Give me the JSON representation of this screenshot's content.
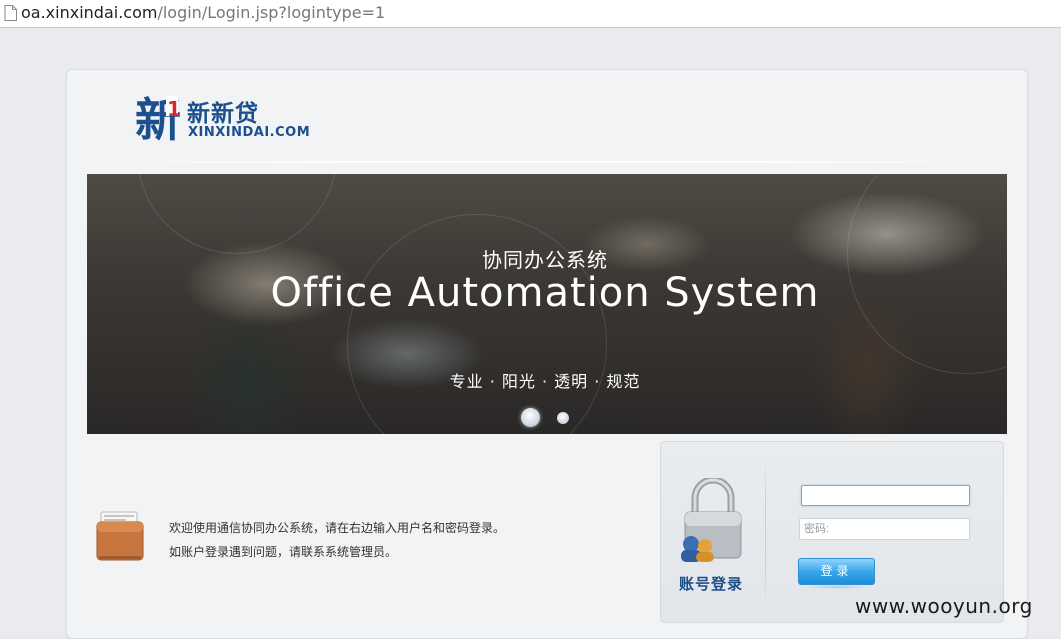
{
  "browser": {
    "url_host": "oa.xinxindai.com",
    "url_path": "/login/Login.jsp?logintype=1",
    "page_icon": "page-icon"
  },
  "logo": {
    "mark_char": "新",
    "mark_digit": "1",
    "cn_name": "新新贷",
    "en_name": "XINXINDAI.COM",
    "brand_color": "#1b4f8e",
    "accent_color": "#d42a2a"
  },
  "banner": {
    "title_cn": "协同办公系统",
    "title_en": "Office Automation System",
    "slogan": "专业 · 阳光 · 透明 · 规范",
    "active_slide": 1,
    "slide_count": 2
  },
  "welcome": {
    "icon": "briefcase-icon",
    "line1": "欢迎使用通信协同办公系统，请在右边输入用户名和密码登录。",
    "line2": "如账户登录遇到问题，请联系系统管理员。"
  },
  "login": {
    "icon": "lock-users-icon",
    "title": "账号登录",
    "username_value": "",
    "password_placeholder": "密码:",
    "submit_label": "登录",
    "button_color": "#2a9ae3"
  },
  "watermark": {
    "text": "www.wooyun.org"
  }
}
